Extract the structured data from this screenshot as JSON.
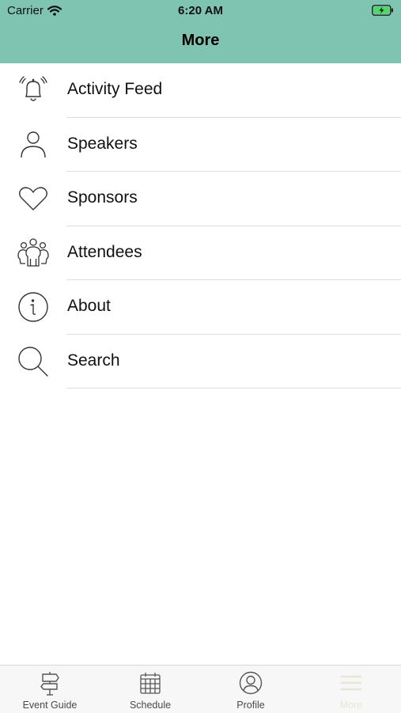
{
  "status_bar": {
    "carrier": "Carrier",
    "time": "6:20 AM"
  },
  "nav": {
    "title": "More"
  },
  "menu": {
    "items": [
      {
        "label": "Activity Feed",
        "icon": "bell-icon"
      },
      {
        "label": "Speakers",
        "icon": "person-icon"
      },
      {
        "label": "Sponsors",
        "icon": "heart-icon"
      },
      {
        "label": "Attendees",
        "icon": "group-icon"
      },
      {
        "label": "About",
        "icon": "info-icon"
      },
      {
        "label": "Search",
        "icon": "search-icon"
      }
    ]
  },
  "tabbar": {
    "tabs": [
      {
        "label": "Event Guide",
        "icon": "signpost-icon"
      },
      {
        "label": "Schedule",
        "icon": "calendar-icon"
      },
      {
        "label": "Profile",
        "icon": "profile-icon"
      },
      {
        "label": "More",
        "icon": "menu-lines-icon",
        "active": true
      }
    ]
  },
  "colors": {
    "header": "#7ec4b0",
    "active_tab": "#e7e5d4",
    "icon_stroke": "#333333"
  }
}
